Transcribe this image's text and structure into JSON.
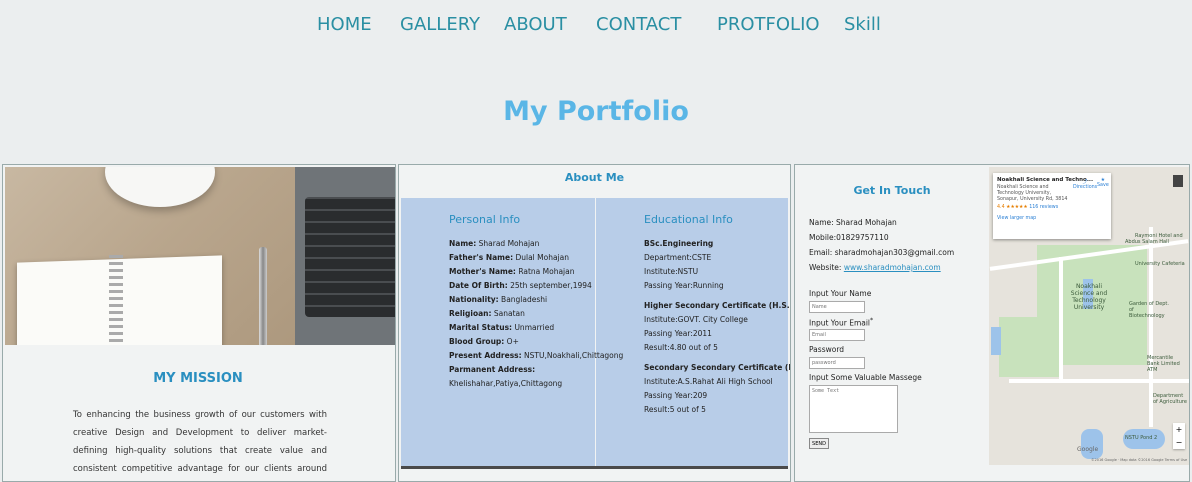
{
  "nav": {
    "items": [
      {
        "label": "HOME"
      },
      {
        "label": "GALLERY"
      },
      {
        "label": "ABOUT"
      },
      {
        "label": "CONTACT"
      },
      {
        "label": "PROTFOLIO"
      },
      {
        "label": "Skill"
      }
    ]
  },
  "page": {
    "title": "My Portfolio"
  },
  "mission": {
    "title": "MY MISSION",
    "text": "To enhancing the business growth of our customers with creative Design and Development to deliver market-defining high-quality solutions that create value and consistent competitive advantage for our clients around the world.\"To Achieve excellence"
  },
  "about": {
    "title": "About Me",
    "personal": {
      "heading": "Personal Info",
      "rows": [
        {
          "label": "Name:",
          "value": " Sharad Mohajan"
        },
        {
          "label": "Father's Name:",
          "value": " Dulal Mohajan"
        },
        {
          "label": "Mother's Name:",
          "value": " Ratna Mohajan"
        },
        {
          "label": "Date Of Birth:",
          "value": " 25th september,1994"
        },
        {
          "label": "Nationality:",
          "value": " Bangladeshi"
        },
        {
          "label": "Religioan:",
          "value": " Sanatan"
        },
        {
          "label": "Marital Status:",
          "value": " Unmarried"
        },
        {
          "label": "Blood Group:",
          "value": " O+"
        },
        {
          "label": "Present Address:",
          "value": " NSTU,Noakhali,Chittagong"
        },
        {
          "label": "Parmanent Address:",
          "value": ""
        },
        {
          "label": "",
          "value": "Khelishahar,Patiya,Chittagong"
        }
      ]
    },
    "educational": {
      "heading": "Educational Info",
      "groups": [
        {
          "title": "BSc.Engineering",
          "lines": [
            "Department:CSTE",
            "Institute:NSTU",
            "Passing Year:Running"
          ]
        },
        {
          "title": "Higher Secondary Certificate (H.S.C)",
          "lines": [
            "Institute:GOVT. City College",
            "Passing Year:2011",
            "Result:4.80 out of 5"
          ]
        },
        {
          "title": "Secondary Secondary Certificate (H.S.C)",
          "lines": [
            "Institute:A.S.Rahat Ali High School",
            "Passing Year:209",
            "Result:5 out of 5"
          ]
        }
      ]
    }
  },
  "contact": {
    "title": "Get In Touch",
    "name": "Name: Sharad Mohajan",
    "mobile": "Mobile:01829757110",
    "email": "Email: sharadmohajan303@gmail.com",
    "website_label": "Website: ",
    "website_link": "www.sharadmohajan.com",
    "form": {
      "name_label": "Input Your Name",
      "name_placeholder": "Name",
      "email_label": "Input Your Email",
      "email_required": "*",
      "email_placeholder": "Email",
      "password_label": "Password",
      "password_placeholder": "password",
      "message_label": "Input Some Valuable Massege",
      "message_placeholder": "Some Text",
      "send_label": "SEND"
    }
  },
  "map": {
    "card": {
      "name": "Noakhali Science and Techno...",
      "address": "Noakhali Science and Technology University, Sonapur, University Rd, 3814",
      "rating": "4.4 ★★★★★",
      "reviews": "116 reviews",
      "directions": "Directions",
      "save": "Save",
      "larger_map": "View larger map"
    },
    "places": [
      "Raymoni Hotel and",
      "Abdus Salam Hall",
      "University Cafeteria",
      "Noakhali Science and Technology University",
      "Garden of Dept. of Biotechnology",
      "Mercantile Bank Limited ATM",
      "Department of Agriculture",
      "NSTU Pond 2"
    ],
    "google": "Google",
    "attribution": "©2016 Google · Map data ©2016 Google   Terms of Use"
  }
}
